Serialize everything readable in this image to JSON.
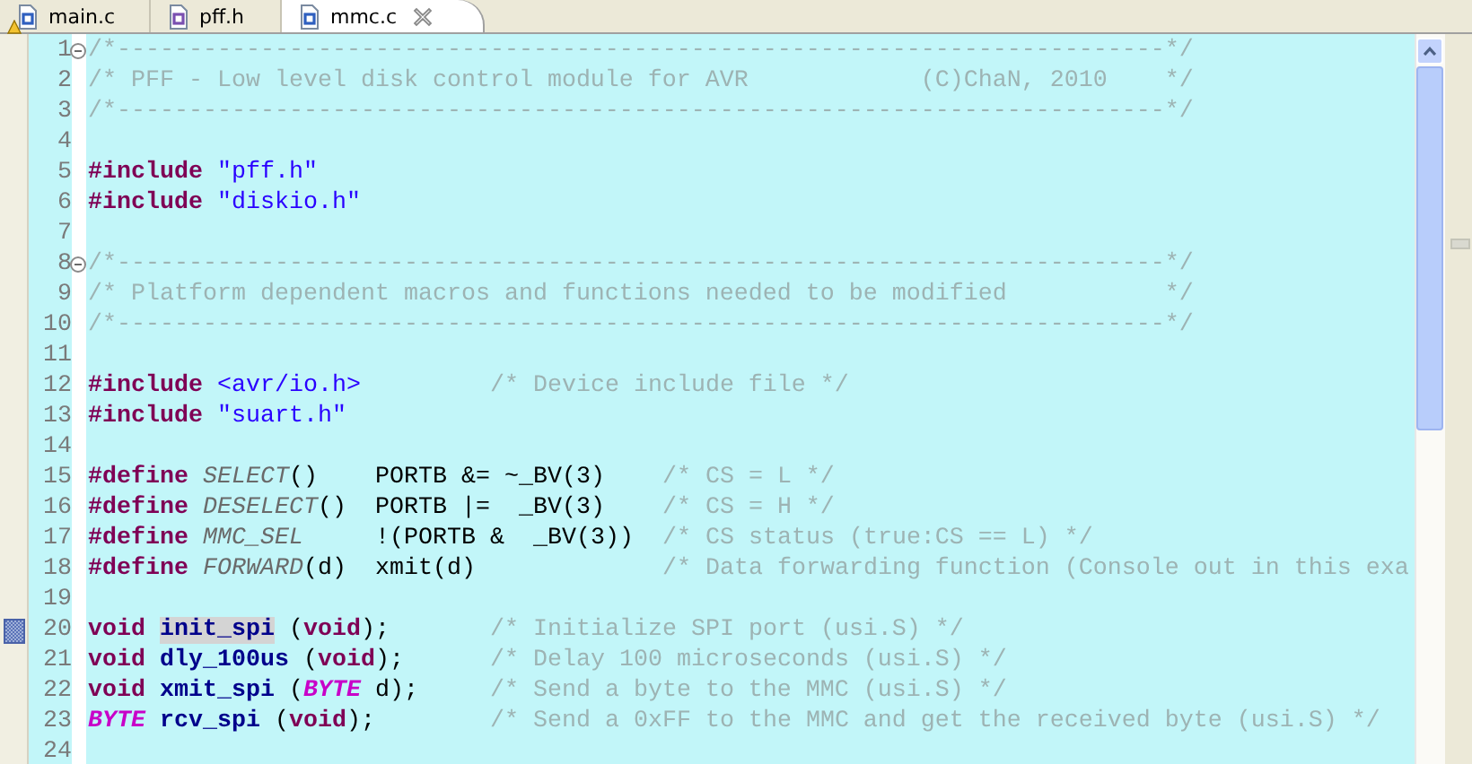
{
  "tabs": [
    {
      "label": "main.c",
      "kind": "c",
      "warning": true,
      "selected": false
    },
    {
      "label": "pff.h",
      "kind": "h",
      "warning": false,
      "selected": false
    },
    {
      "label": "mmc.c",
      "kind": "c",
      "warning": false,
      "selected": true
    }
  ],
  "editor": {
    "lines": [
      {
        "number": "1",
        "fold": true,
        "marked": false,
        "tokens": [
          {
            "kind": "comment",
            "text": "/*-------------------------------------------------------------------------*/"
          }
        ]
      },
      {
        "number": "2",
        "fold": false,
        "marked": false,
        "tokens": [
          {
            "kind": "comment",
            "text": "/* PFF - Low level disk control module for AVR            (C)ChaN, 2010    */"
          }
        ]
      },
      {
        "number": "3",
        "fold": false,
        "marked": false,
        "tokens": [
          {
            "kind": "comment",
            "text": "/*-------------------------------------------------------------------------*/"
          }
        ]
      },
      {
        "number": "4",
        "fold": false,
        "marked": false
      },
      {
        "number": "5",
        "fold": false,
        "marked": false,
        "tokens": [
          {
            "kind": "keyword",
            "text": "#include"
          },
          {
            "kind": "string",
            "text": " \"pff.h\""
          }
        ]
      },
      {
        "number": "6",
        "fold": false,
        "marked": false,
        "tokens": [
          {
            "kind": "keyword",
            "text": "#include"
          },
          {
            "kind": "string",
            "text": " \"diskio.h\""
          }
        ]
      },
      {
        "number": "7",
        "fold": false,
        "marked": false
      },
      {
        "number": "8",
        "fold": true,
        "marked": false,
        "tokens": [
          {
            "kind": "comment",
            "text": "/*-------------------------------------------------------------------------*/"
          }
        ]
      },
      {
        "number": "9",
        "fold": false,
        "marked": false,
        "tokens": [
          {
            "kind": "comment",
            "text": "/* Platform dependent macros and functions needed to be modified           */"
          }
        ]
      },
      {
        "number": "10",
        "fold": false,
        "marked": false,
        "tokens": [
          {
            "kind": "comment",
            "text": "/*-------------------------------------------------------------------------*/"
          }
        ]
      },
      {
        "number": "11",
        "fold": false,
        "marked": false
      },
      {
        "number": "12",
        "fold": false,
        "marked": false,
        "tokens": [
          {
            "kind": "keyword",
            "text": "#include"
          },
          {
            "kind": "string",
            "text": " <avr/io.h>"
          },
          {
            "kind": "comment",
            "text": "         /* Device include file */"
          }
        ]
      },
      {
        "number": "13",
        "fold": false,
        "marked": false,
        "tokens": [
          {
            "kind": "keyword",
            "text": "#include"
          },
          {
            "kind": "string",
            "text": " \"suart.h\""
          }
        ]
      },
      {
        "number": "14",
        "fold": false,
        "marked": false
      },
      {
        "number": "15",
        "fold": false,
        "marked": false,
        "tokens": [
          {
            "kind": "keyword",
            "text": "#define"
          },
          {
            "kind": "macro",
            "text": " SELECT"
          },
          {
            "kind": "plain",
            "text": "()    PORTB &= ~_BV(3)    "
          },
          {
            "kind": "comment",
            "text": "/* CS = L */"
          }
        ]
      },
      {
        "number": "16",
        "fold": false,
        "marked": false,
        "tokens": [
          {
            "kind": "keyword",
            "text": "#define"
          },
          {
            "kind": "macro",
            "text": " DESELECT"
          },
          {
            "kind": "plain",
            "text": "()  PORTB |=  _BV(3)    "
          },
          {
            "kind": "comment",
            "text": "/* CS = H */"
          }
        ]
      },
      {
        "number": "17",
        "fold": false,
        "marked": false,
        "tokens": [
          {
            "kind": "keyword",
            "text": "#define"
          },
          {
            "kind": "macro",
            "text": " MMC_SEL"
          },
          {
            "kind": "plain",
            "text": "     !(PORTB &  _BV(3))  "
          },
          {
            "kind": "comment",
            "text": "/* CS status (true:CS == L) */"
          }
        ]
      },
      {
        "number": "18",
        "fold": false,
        "marked": false,
        "tokens": [
          {
            "kind": "keyword",
            "text": "#define"
          },
          {
            "kind": "macro",
            "text": " FORWARD"
          },
          {
            "kind": "plain",
            "text": "(d)  xmit(d)             "
          },
          {
            "kind": "comment",
            "text": "/* Data forwarding function (Console out in this exa"
          }
        ]
      },
      {
        "number": "19",
        "fold": false,
        "marked": false
      },
      {
        "number": "20",
        "fold": false,
        "marked": true,
        "tokens": [
          {
            "kind": "keyword",
            "text": "void "
          },
          {
            "kind": "occurrence",
            "text": "init_spi"
          },
          {
            "kind": "plain",
            "text": " ("
          },
          {
            "kind": "keyword",
            "text": "void"
          },
          {
            "kind": "plain",
            "text": ");       "
          },
          {
            "kind": "comment",
            "text": "/* Initialize SPI port (usi.S) */"
          }
        ]
      },
      {
        "number": "21",
        "fold": false,
        "marked": false,
        "tokens": [
          {
            "kind": "keyword",
            "text": "void"
          },
          {
            "kind": "function",
            "text": " dly_100us"
          },
          {
            "kind": "plain",
            "text": " ("
          },
          {
            "kind": "keyword",
            "text": "void"
          },
          {
            "kind": "plain",
            "text": ");      "
          },
          {
            "kind": "comment",
            "text": "/* Delay 100 microseconds (usi.S) */"
          }
        ]
      },
      {
        "number": "22",
        "fold": false,
        "marked": false,
        "tokens": [
          {
            "kind": "keyword",
            "text": "void"
          },
          {
            "kind": "function",
            "text": " xmit_spi"
          },
          {
            "kind": "plain",
            "text": " ("
          },
          {
            "kind": "type",
            "text": "BYTE"
          },
          {
            "kind": "plain",
            "text": " d);     "
          },
          {
            "kind": "comment",
            "text": "/* Send a byte to the MMC (usi.S) */"
          }
        ]
      },
      {
        "number": "23",
        "fold": false,
        "marked": false,
        "tokens": [
          {
            "kind": "type",
            "text": "BYTE"
          },
          {
            "kind": "function",
            "text": " rcv_spi"
          },
          {
            "kind": "plain",
            "text": " ("
          },
          {
            "kind": "keyword",
            "text": "void"
          },
          {
            "kind": "plain",
            "text": ");        "
          },
          {
            "kind": "comment",
            "text": "/* Send a 0xFF to the MMC and get the received byte (usi.S) */"
          }
        ]
      },
      {
        "number": "24",
        "fold": false,
        "marked": false
      }
    ]
  }
}
